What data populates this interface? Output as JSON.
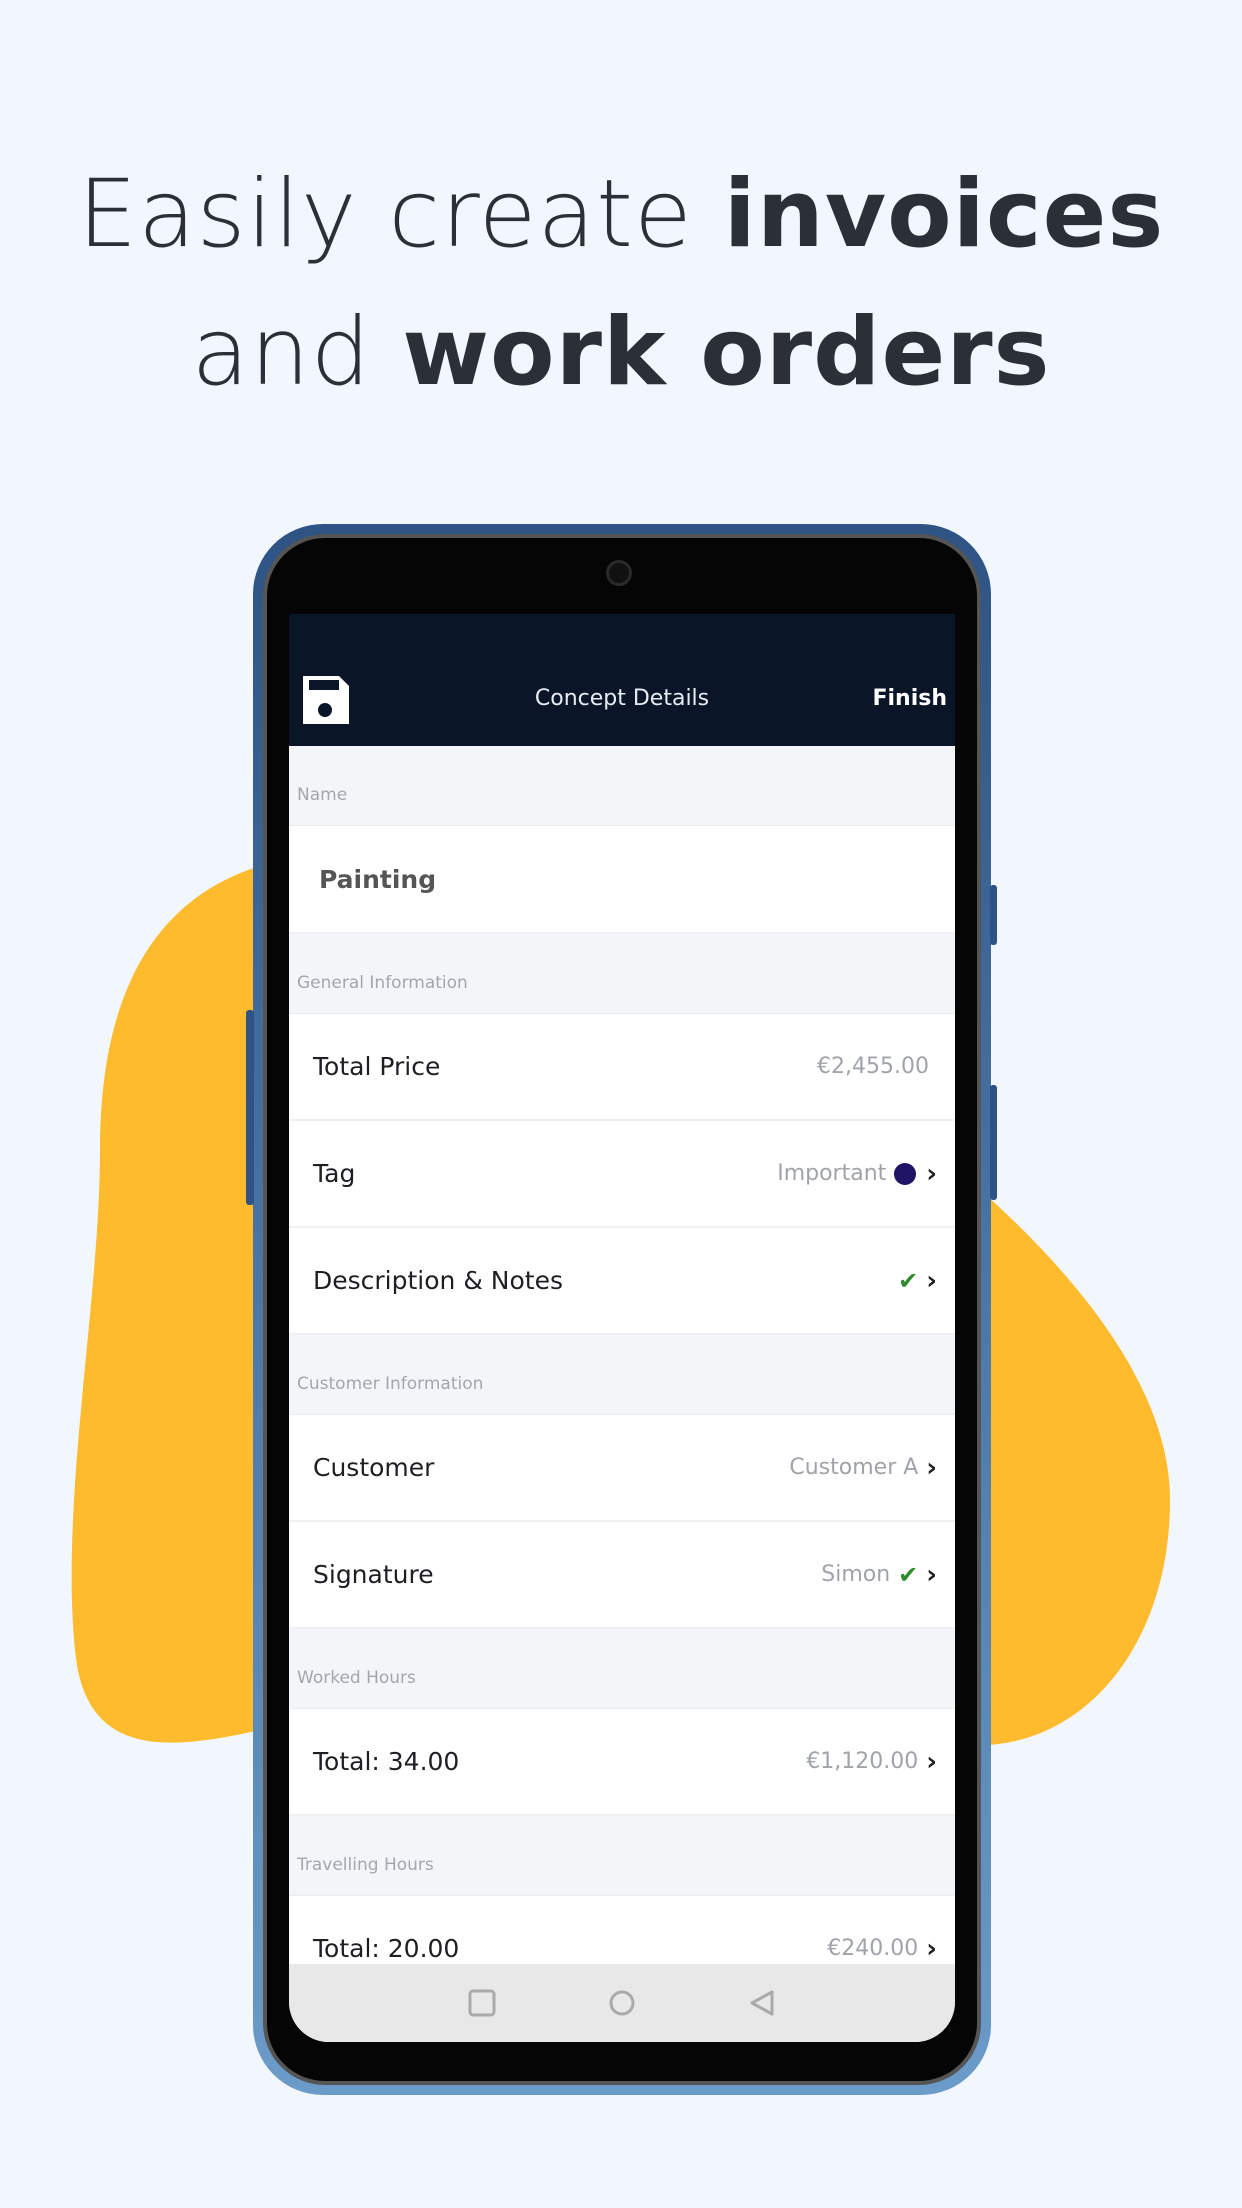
{
  "headline": {
    "line1_regular": "Easily create ",
    "line1_bold": "invoices",
    "line2_regular": "and ",
    "line2_bold": "work orders"
  },
  "colors": {
    "background": "#f2f6fd",
    "blob": "#fdbb2d",
    "appbar": "#0a1628",
    "tag_dot": "#1f1466",
    "check": "#2e8b2e"
  },
  "appbar": {
    "icon": "save-icon",
    "title": "Concept Details",
    "finish": "Finish"
  },
  "sections": {
    "name": {
      "label": "Name",
      "value": "Painting"
    },
    "general": {
      "label": "General Information",
      "rows": [
        {
          "label": "Total Price",
          "value": "€2,455.00"
        },
        {
          "label": "Tag",
          "value": "Important"
        },
        {
          "label": "Description & Notes",
          "value": ""
        }
      ]
    },
    "customer": {
      "label": "Customer Information",
      "rows": [
        {
          "label": "Customer",
          "value": "Customer A"
        },
        {
          "label": "Signature",
          "value": "Simon"
        }
      ]
    },
    "worked": {
      "label": "Worked Hours",
      "row": {
        "label": "Total: 34.00",
        "value": "€1,120.00"
      }
    },
    "travelling": {
      "label": "Travelling Hours",
      "row": {
        "label": "Total: 20.00",
        "value": "€240.00"
      }
    }
  },
  "navbar": {
    "icons": [
      "recents-square-icon",
      "home-circle-icon",
      "back-triangle-icon"
    ]
  }
}
